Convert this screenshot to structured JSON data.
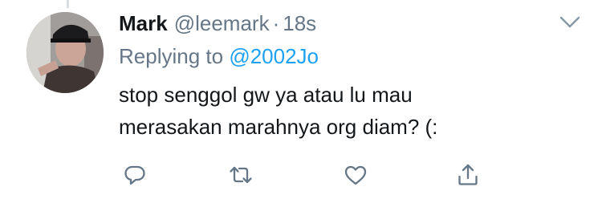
{
  "tweet": {
    "display_name": "Mark",
    "handle": "@leemark",
    "separator": "·",
    "time": "18s",
    "replying_prefix": "Replying to",
    "replying_to": "@2002Jo",
    "text_lines": [
      "stop senggol gw ya atau lu mau",
      "merasakan marahnya org diam? (:"
    ]
  },
  "icons": {
    "menu": "chevron-down-icon",
    "reply": "reply-icon",
    "retweet": "retweet-icon",
    "like": "heart-icon",
    "share": "share-icon"
  },
  "colors": {
    "text": "#14171a",
    "secondary": "#657786",
    "link": "#1da1f2",
    "icon": "#657786",
    "thread_line": "#d9dde1"
  }
}
